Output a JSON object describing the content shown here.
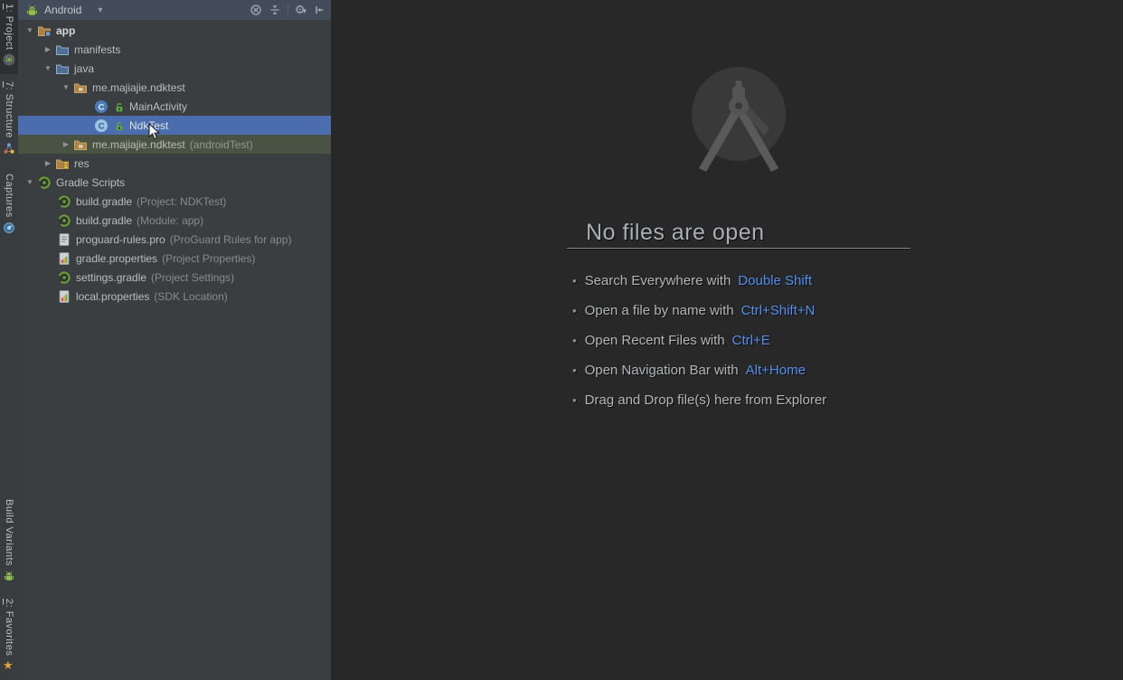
{
  "stripe": {
    "items": [
      {
        "mnemonic": "1",
        "label": ": Project",
        "icon": "android-project-icon"
      },
      {
        "mnemonic": "7",
        "label": ": Structure",
        "icon": "structure-icon"
      },
      {
        "mnemonic": "",
        "label": "Captures",
        "icon": "captures-icon"
      },
      {
        "mnemonic": "",
        "label": "Build Variants",
        "icon": "android-icon"
      },
      {
        "mnemonic": "2",
        "label": ": Favorites",
        "icon": "star-icon"
      }
    ]
  },
  "project_panel": {
    "mode_label": "Android",
    "toolbar_icons": [
      "locate-icon",
      "collapse-all-icon",
      "settings-gear-icon",
      "hide-panel-icon"
    ]
  },
  "tree": {
    "rows": [
      {
        "label": "app",
        "annotation": "",
        "icon": "module-folder-icon"
      },
      {
        "label": "manifests",
        "annotation": "",
        "icon": "folder-icon"
      },
      {
        "label": "java",
        "annotation": "",
        "icon": "folder-icon"
      },
      {
        "label": "me.majiajie.ndktest",
        "annotation": "",
        "icon": "package-icon"
      },
      {
        "label": "MainActivity",
        "annotation": "",
        "icon": "class-icon"
      },
      {
        "label": "NdkTest",
        "annotation": "",
        "icon": "class-icon",
        "selected": true
      },
      {
        "label": "me.majiajie.ndktest",
        "annotation": "(androidTest)",
        "icon": "package-icon"
      },
      {
        "label": "res",
        "annotation": "",
        "icon": "res-folder-icon"
      },
      {
        "label": "Gradle Scripts",
        "annotation": "",
        "icon": "gradle-icon"
      },
      {
        "label": "build.gradle",
        "annotation": "(Project: NDKTest)",
        "icon": "gradle-icon"
      },
      {
        "label": "build.gradle",
        "annotation": "(Module: app)",
        "icon": "gradle-icon"
      },
      {
        "label": "proguard-rules.pro",
        "annotation": "(ProGuard Rules for app)",
        "icon": "text-file-icon"
      },
      {
        "label": "gradle.properties",
        "annotation": "(Project Properties)",
        "icon": "properties-file-icon"
      },
      {
        "label": "settings.gradle",
        "annotation": "(Project Settings)",
        "icon": "gradle-icon"
      },
      {
        "label": "local.properties",
        "annotation": "(SDK Location)",
        "icon": "properties-file-icon"
      }
    ]
  },
  "empty_state": {
    "title": "No files are open",
    "tips": [
      {
        "text": "Search Everywhere with",
        "shortcut": "Double Shift"
      },
      {
        "text": "Open a file by name with",
        "shortcut": "Ctrl+Shift+N"
      },
      {
        "text": "Open Recent Files with",
        "shortcut": "Ctrl+E"
      },
      {
        "text": "Open Navigation Bar with",
        "shortcut": "Alt+Home"
      },
      {
        "text": "Drag and Drop file(s) here from Explorer",
        "shortcut": ""
      }
    ]
  },
  "icons": {
    "expanded": "▼",
    "collapsed": "▶",
    "caret": "▾",
    "gear": "⚙",
    "bullet": "•",
    "star": "★"
  },
  "colors": {
    "selection_blue": "#4b6dad",
    "test_row_green": "#4a5243",
    "shortcut_blue": "#5590ef",
    "panel_bg": "#3a3e41",
    "editor_bg": "#282828",
    "header_bg": "#434c5a"
  }
}
